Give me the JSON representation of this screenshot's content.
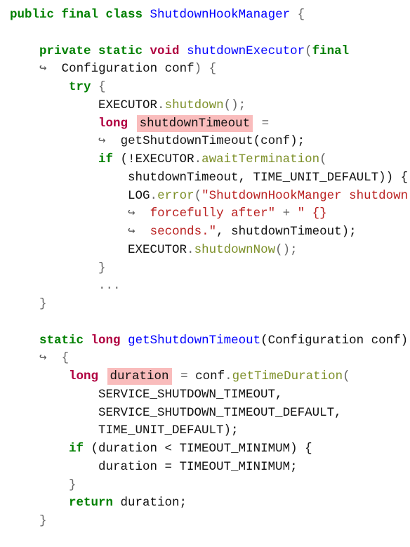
{
  "colors": {
    "keyword": "#008000",
    "type": "#b00040",
    "name": "#0000ff",
    "method": "#7d9029",
    "string": "#ba2121",
    "highlight": "#f9bcbc"
  },
  "lines": [
    [
      {
        "t": "public final class ",
        "c": "kw"
      },
      {
        "t": "ShutdownHookManager",
        "c": "fn"
      },
      {
        "t": " {",
        "c": "p"
      }
    ],
    [],
    [
      {
        "t": "    "
      },
      {
        "t": "private static ",
        "c": "kw"
      },
      {
        "t": "void",
        "c": "kt"
      },
      {
        "t": " "
      },
      {
        "t": "shutdownExecutor",
        "c": "fn"
      },
      {
        "t": "(",
        "c": "p"
      },
      {
        "t": "final",
        "c": "kw"
      }
    ],
    [
      {
        "t": "    "
      },
      {
        "t": "↪",
        "c": "ar"
      },
      {
        "t": "  Configuration conf"
      },
      {
        "t": ") {",
        "c": "p"
      }
    ],
    [
      {
        "t": "        "
      },
      {
        "t": "try",
        "c": "kw"
      },
      {
        "t": " {",
        "c": "p"
      }
    ],
    [
      {
        "t": "            EXECUTOR"
      },
      {
        "t": ".",
        "c": "p"
      },
      {
        "t": "shutdown",
        "c": "mt"
      },
      {
        "t": "();",
        "c": "p"
      }
    ],
    [
      {
        "t": "            "
      },
      {
        "t": "long",
        "c": "kt"
      },
      {
        "t": " "
      },
      {
        "t": "shutdownTimeout",
        "c": "hl"
      },
      {
        "t": " =",
        "c": "p"
      }
    ],
    [
      {
        "t": "            "
      },
      {
        "t": "↪",
        "c": "ar"
      },
      {
        "t": "  getShutdownTimeout(conf);"
      }
    ],
    [
      {
        "t": "            "
      },
      {
        "t": "if",
        "c": "kw"
      },
      {
        "t": " (!EXECUTOR"
      },
      {
        "t": ".",
        "c": "p"
      },
      {
        "t": "awaitTermination",
        "c": "mt"
      },
      {
        "t": "(",
        "c": "p"
      }
    ],
    [
      {
        "t": "                shutdownTimeout, TIME_UNIT_DEFAULT)) {"
      }
    ],
    [
      {
        "t": "                LOG"
      },
      {
        "t": ".",
        "c": "p"
      },
      {
        "t": "error",
        "c": "mt"
      },
      {
        "t": "(",
        "c": "p"
      },
      {
        "t": "\"ShutdownHookManger shutdown",
        "c": "s"
      }
    ],
    [
      {
        "t": "                "
      },
      {
        "t": "↪",
        "c": "ar"
      },
      {
        "t": "  "
      },
      {
        "t": "forcefully after\"",
        "c": "s"
      },
      {
        "t": " + ",
        "c": "p"
      },
      {
        "t": "\" {}",
        "c": "s"
      }
    ],
    [
      {
        "t": "                "
      },
      {
        "t": "↪",
        "c": "ar"
      },
      {
        "t": "  "
      },
      {
        "t": "seconds.\"",
        "c": "s"
      },
      {
        "t": ", shutdownTimeout);"
      }
    ],
    [
      {
        "t": "                EXECUTOR"
      },
      {
        "t": ".",
        "c": "p"
      },
      {
        "t": "shutdownNow",
        "c": "mt"
      },
      {
        "t": "();",
        "c": "p"
      }
    ],
    [
      {
        "t": "            }",
        "c": "p"
      }
    ],
    [
      {
        "t": "            ...",
        "c": "p"
      }
    ],
    [
      {
        "t": "    }",
        "c": "p"
      }
    ],
    [],
    [
      {
        "t": "    "
      },
      {
        "t": "static ",
        "c": "kw"
      },
      {
        "t": "long",
        "c": "kt"
      },
      {
        "t": " "
      },
      {
        "t": "getShutdownTimeout",
        "c": "fn"
      },
      {
        "t": "(Configuration conf)"
      }
    ],
    [
      {
        "t": "    "
      },
      {
        "t": "↪",
        "c": "ar"
      },
      {
        "t": "  {",
        "c": "p"
      }
    ],
    [
      {
        "t": "        "
      },
      {
        "t": "long",
        "c": "kt"
      },
      {
        "t": " "
      },
      {
        "t": "duration",
        "c": "hl"
      },
      {
        "t": " = ",
        "c": "p"
      },
      {
        "t": "conf"
      },
      {
        "t": ".",
        "c": "p"
      },
      {
        "t": "getTimeDuration",
        "c": "mt"
      },
      {
        "t": "(",
        "c": "p"
      }
    ],
    [
      {
        "t": "            SERVICE_SHUTDOWN_TIMEOUT,"
      }
    ],
    [
      {
        "t": "            SERVICE_SHUTDOWN_TIMEOUT_DEFAULT,"
      }
    ],
    [
      {
        "t": "            TIME_UNIT_DEFAULT);"
      }
    ],
    [
      {
        "t": "        "
      },
      {
        "t": "if",
        "c": "kw"
      },
      {
        "t": " (duration < TIMEOUT_MINIMUM) {"
      }
    ],
    [
      {
        "t": "            duration = TIMEOUT_MINIMUM;"
      }
    ],
    [
      {
        "t": "        }",
        "c": "p"
      }
    ],
    [
      {
        "t": "        "
      },
      {
        "t": "return",
        "c": "kw"
      },
      {
        "t": " duration;"
      }
    ],
    [
      {
        "t": "    }",
        "c": "p"
      }
    ]
  ]
}
